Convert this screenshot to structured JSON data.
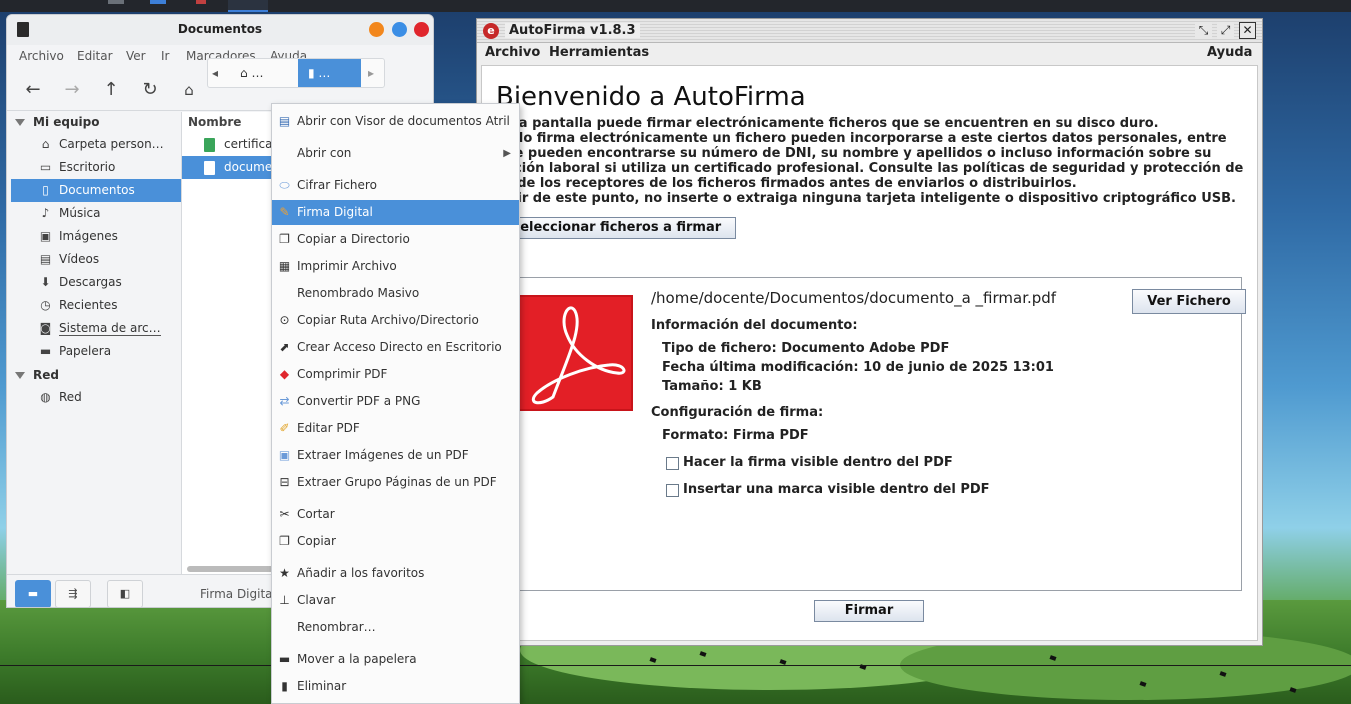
{
  "file_manager": {
    "title": "Documentos",
    "menu": [
      "Archivo",
      "Editar",
      "Ver",
      "Ir",
      "Marcadores",
      "Ayuda"
    ],
    "path": {
      "home": "…",
      "current": "…"
    },
    "sidebar": {
      "section_mi_equipo": "Mi equipo",
      "items": [
        {
          "label": "Carpeta person…",
          "icon": "home-icon"
        },
        {
          "label": "Escritorio",
          "icon": "desktop-icon"
        },
        {
          "label": "Documentos",
          "icon": "document-icon"
        },
        {
          "label": "Música",
          "icon": "music-icon"
        },
        {
          "label": "Imágenes",
          "icon": "image-icon"
        },
        {
          "label": "Vídeos",
          "icon": "video-icon"
        },
        {
          "label": "Descargas",
          "icon": "download-icon"
        },
        {
          "label": "Recientes",
          "icon": "clock-icon"
        },
        {
          "label": "Sistema de arc…",
          "icon": "drive-icon"
        },
        {
          "label": "Papelera",
          "icon": "trash-icon"
        }
      ],
      "section_red": "Red",
      "network_items": [
        {
          "label": "Red",
          "icon": "globe-icon"
        }
      ]
    },
    "list": {
      "column_name": "Nombre",
      "files": [
        "certificad",
        "documen"
      ]
    },
    "status_text": "Firma Digital"
  },
  "autofirma": {
    "title": "AutoFirma v1.8.3",
    "menu": {
      "archivo": "Archivo",
      "herramientas": "Herramientas",
      "ayuda": "Ayuda"
    },
    "heading": "Bienvenido a AutoFirma",
    "paragraphs": [
      "esta pantalla puede firmar electrónicamente ficheros que se encuentren en su disco duro.",
      "ando firma electrónicamente un fichero pueden incorporarse a este ciertos datos personales, entre",
      "que pueden encontrarse su número de DNI, su nombre y apellidos o incluso información sobre su",
      "nación laboral si utiliza un certificado profesional. Consulte las políticas de seguridad y protección de",
      "os de los receptores de los ficheros firmados antes de enviarlos o distribuirlos.",
      "artir de este punto, no inserte o extraiga ninguna tarjeta inteligente o dispositivo criptográfico USB."
    ],
    "select_button": "Seleccionar ficheros a firmar",
    "file_path": "/home/docente/Documentos/documento_a _firmar.pdf",
    "view_button": "Ver Fichero",
    "doc_info_label": "Información del documento:",
    "file_type": "Tipo de fichero: Documento Adobe PDF",
    "last_modified": "Fecha última modificación: 10 de junio de 2025 13:01",
    "size": "Tamaño: 1 KB",
    "sign_config_label": "Configuración de firma:",
    "format": "Formato: Firma PDF",
    "checkbox_visible_signature": "Hacer la firma visible dentro del PDF",
    "checkbox_visible_mark": "Insertar una marca visible dentro del PDF",
    "sign_button": "Firmar"
  },
  "context_menu": {
    "items": [
      {
        "label": "Abrir con Visor de documentos Atril",
        "icon": "document-viewer-icon"
      },
      {
        "label": "Abrir con",
        "icon": "",
        "submenu": true
      },
      {
        "label": "Cifrar Fichero",
        "icon": "encrypt-icon"
      },
      {
        "label": "Firma Digital",
        "icon": "signature-icon"
      },
      {
        "label": "Copiar a Directorio",
        "icon": "copy-icon"
      },
      {
        "label": "Imprimir Archivo",
        "icon": "printer-icon"
      },
      {
        "label": "Renombrado Masivo",
        "icon": ""
      },
      {
        "label": "Copiar Ruta Archivo/Directorio",
        "icon": "location-icon"
      },
      {
        "label": "Crear Acceso Directo en Escritorio",
        "icon": "shortcut-icon"
      },
      {
        "label": "Comprimir PDF",
        "icon": "pdf-icon"
      },
      {
        "label": "Convertir PDF a PNG",
        "icon": "convert-icon"
      },
      {
        "label": "Editar PDF",
        "icon": "edit-icon"
      },
      {
        "label": "Extraer Imágenes de un PDF",
        "icon": "images-icon"
      },
      {
        "label": "Extraer Grupo Páginas de un PDF",
        "icon": "pages-icon"
      },
      {
        "label": "Cortar",
        "icon": "scissors-icon"
      },
      {
        "label": "Copiar",
        "icon": "copy-icon"
      },
      {
        "label": "Añadir a los favoritos",
        "icon": "star-icon"
      },
      {
        "label": "Clavar",
        "icon": "pin-icon"
      },
      {
        "label": "Renombrar…",
        "icon": ""
      },
      {
        "label": "Mover a la papelera",
        "icon": "trash-icon"
      },
      {
        "label": "Eliminar",
        "icon": "delete-icon"
      }
    ]
  },
  "colors": {
    "selection": "#4a90d9",
    "pdf_red": "#e31f26"
  }
}
